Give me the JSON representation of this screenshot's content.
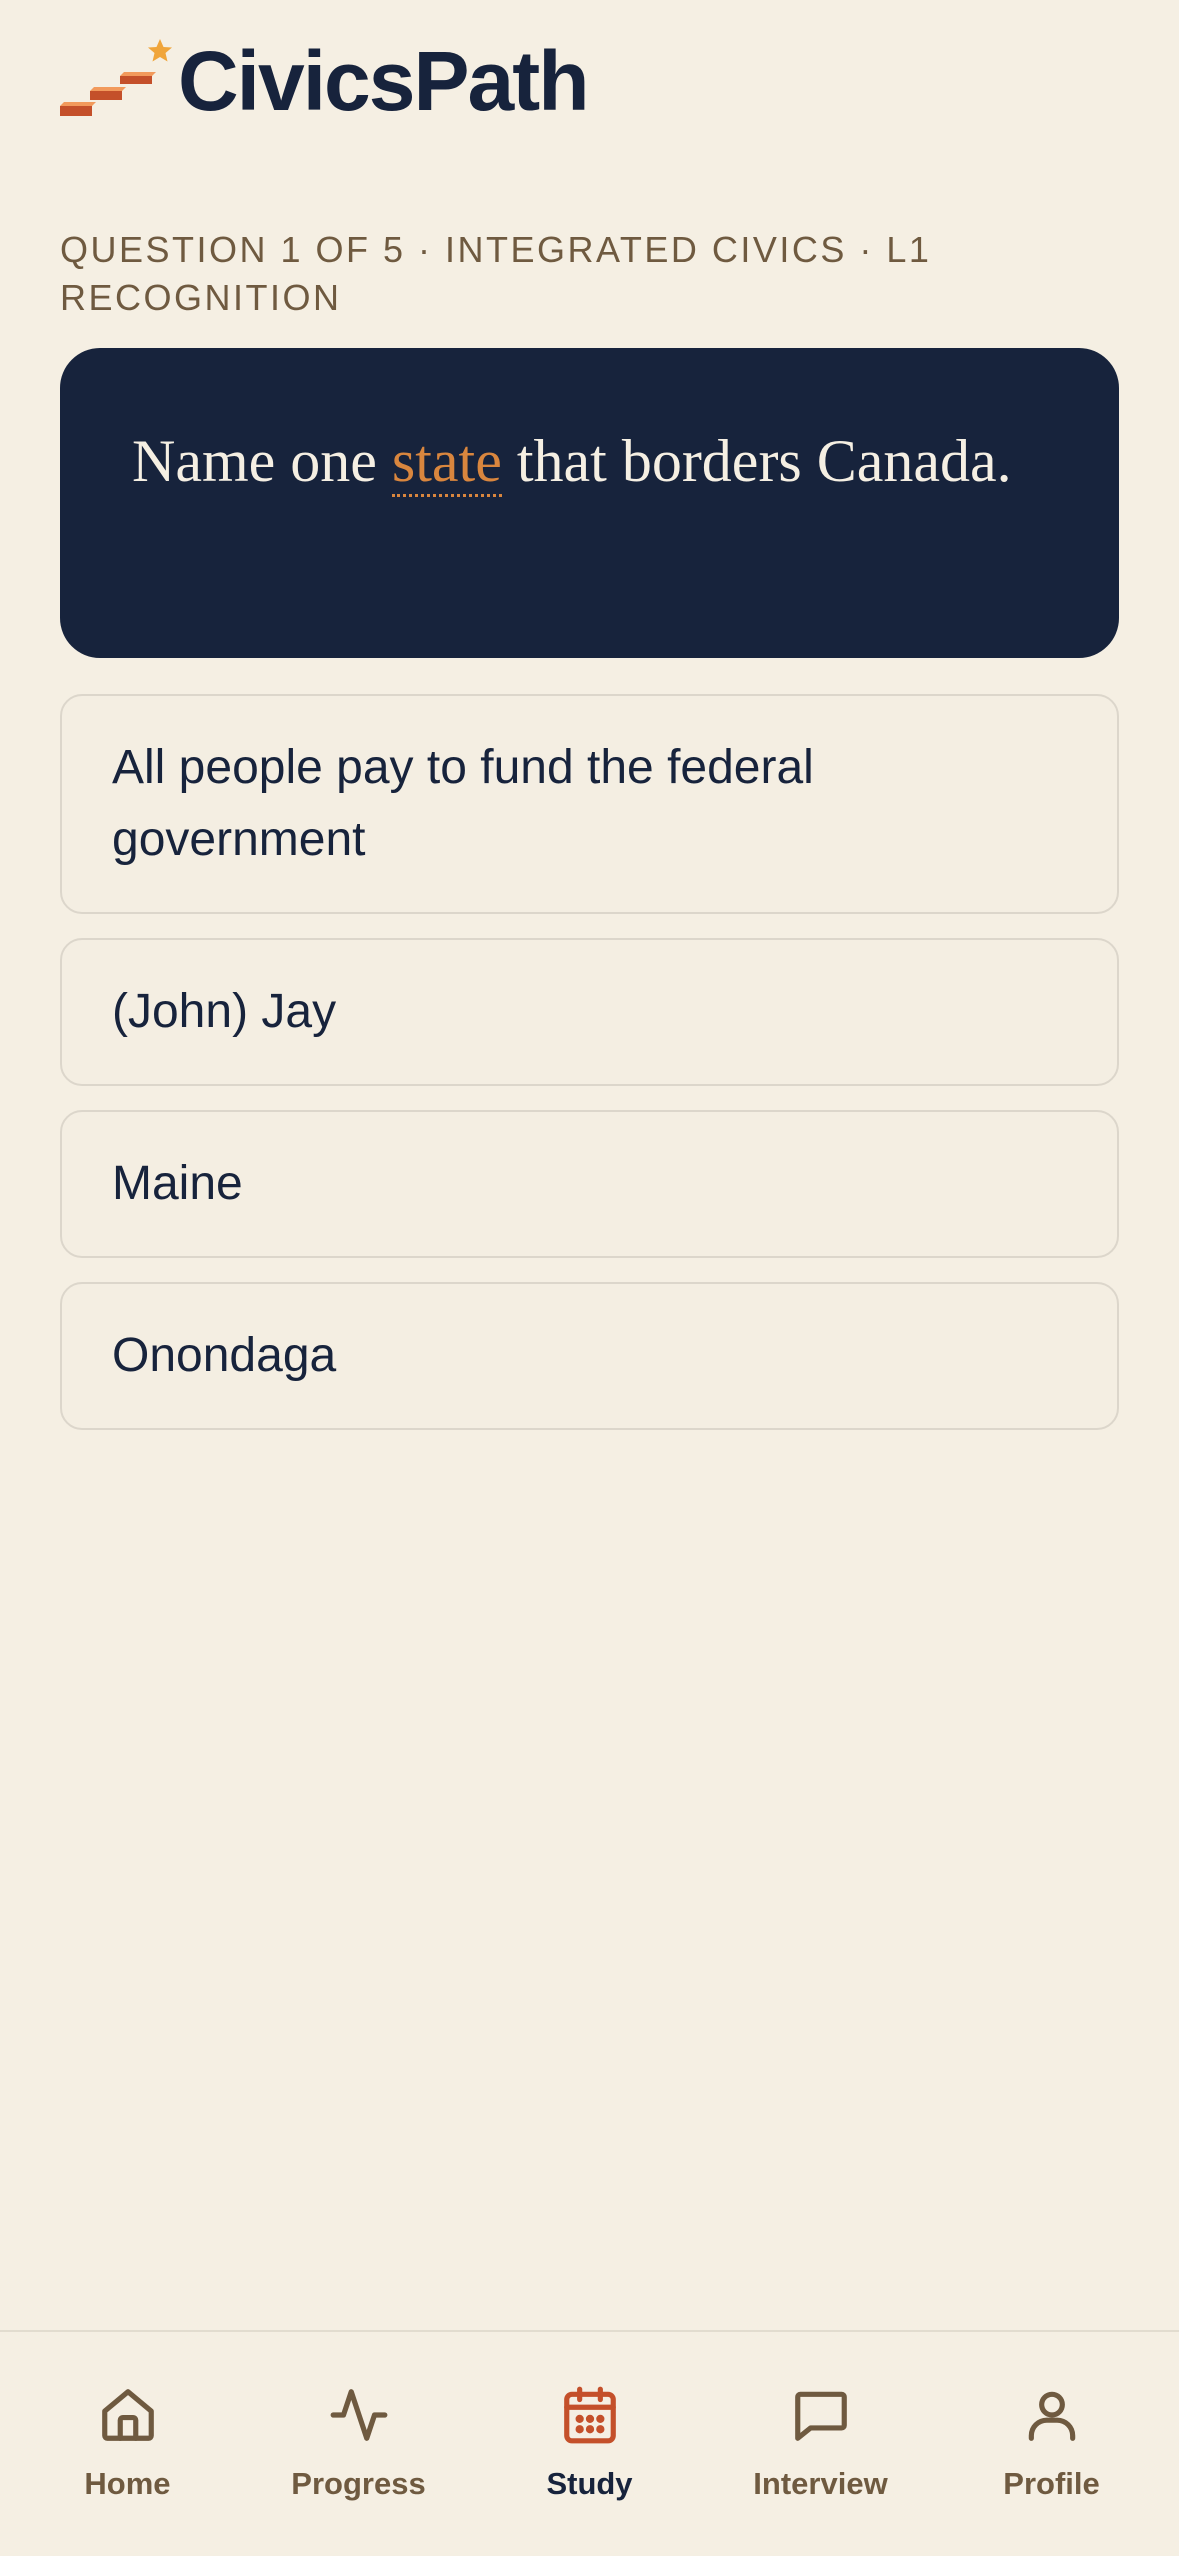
{
  "app": {
    "name": "CivicsPath"
  },
  "colors": {
    "background": "#f5efe3",
    "navy": "#17233c",
    "accent": "#d9863e",
    "accent_dark": "#c4502a",
    "muted": "#6f5a40",
    "star": "#f0a53a"
  },
  "quiz": {
    "meta": "QUESTION 1 OF 5 · INTEGRATED CIVICS · L1 RECOGNITION",
    "question": {
      "before": "Name one ",
      "keyword": "state",
      "after": " that borders Canada."
    },
    "options": [
      "All people pay to fund the federal government",
      "(John) Jay",
      "Maine",
      "Onondaga"
    ]
  },
  "nav": {
    "active": "Study",
    "items": [
      {
        "label": "Home",
        "icon": "home-icon"
      },
      {
        "label": "Progress",
        "icon": "activity-icon"
      },
      {
        "label": "Study",
        "icon": "calendar-icon"
      },
      {
        "label": "Interview",
        "icon": "chat-bubble-icon"
      },
      {
        "label": "Profile",
        "icon": "user-icon"
      }
    ]
  }
}
